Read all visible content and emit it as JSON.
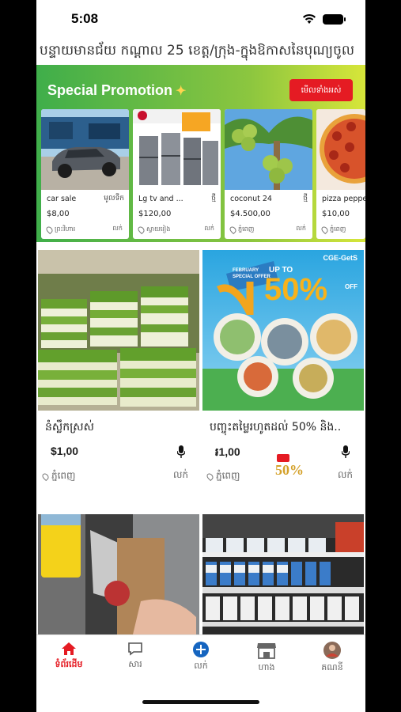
{
  "status": {
    "time": "5:08"
  },
  "marquee": {
    "text": "បន្ទាយមានជ័យ  កណ្តាល 25 ខេត្ត/ក្រុង-ក្នុងឱកាសនៃបុណ្យចូល"
  },
  "promo": {
    "title": "Special Promotion",
    "title_icon": "sparkle-icon",
    "button_label": "មើលទាំងអស់",
    "cards": [
      {
        "title": "car sale",
        "tag": "មូលទឹក",
        "price": "$8,00",
        "location": "ព្រះវិហារ",
        "sell": "លក់",
        "image": "car"
      },
      {
        "title": "Lg tv and ...",
        "tag": "ថ្មី",
        "price": "$120,00",
        "location": "ស្វាយរៀង",
        "sell": "លក់",
        "image": "fridge"
      },
      {
        "title": "coconut 24",
        "tag": "ថ្មី",
        "price": "$4.500,00",
        "location": "ភ្នំពេញ",
        "sell": "លក់",
        "image": "coconut"
      },
      {
        "title": "pizza pepper",
        "tag": "",
        "price": "$10,00",
        "location": "ភ្នំពេញ",
        "sell": "លក់",
        "image": "pizza"
      }
    ]
  },
  "listings": [
    {
      "title": "នំស្លឹកស្រស់",
      "price": "$1,00",
      "location": "ភ្នំពេញ",
      "sell": "លក់",
      "image": "cake"
    },
    {
      "title": "បញ្ចុះតម្លៃរហូតដល់ 50% និង..",
      "price": "៛1,00",
      "location": "ភ្នំពេញ",
      "sell": "លក់",
      "image": "promo-food",
      "badge_text": "50%",
      "banner_brand": "CGE-GetS",
      "banner_tag": "FEBRUARY SPECIAL OFFER",
      "banner_up": "UP TO",
      "banner_pct": "50%",
      "banner_off": "OFF"
    },
    {
      "title": "",
      "image": "kitchen"
    },
    {
      "title": "",
      "image": "shelf"
    }
  ],
  "tabs": [
    {
      "label": "ទំព័រដើម",
      "icon": "home-icon",
      "active": true
    },
    {
      "label": "សារ",
      "icon": "chat-icon",
      "active": false
    },
    {
      "label": "លក់",
      "icon": "plus-circle-icon",
      "active": false
    },
    {
      "label": "ហាង",
      "icon": "store-icon",
      "active": false
    },
    {
      "label": "គណនី",
      "icon": "avatar-icon",
      "active": false
    }
  ],
  "colors": {
    "accent": "#e51b23",
    "promo_green": "#3fae4a",
    "promo_yellow": "#d7e63a"
  }
}
